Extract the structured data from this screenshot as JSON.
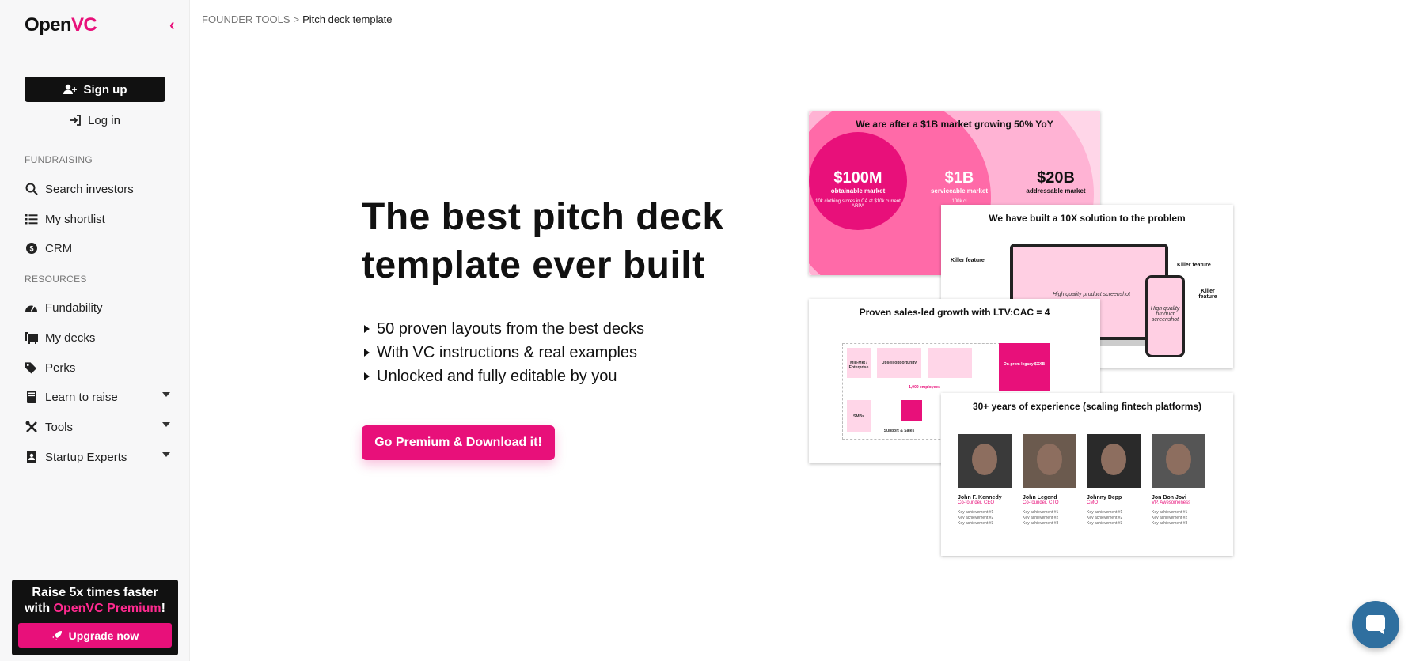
{
  "sidebar": {
    "logo": {
      "prefix": "Open",
      "accent": "VC"
    },
    "signup_label": "Sign up",
    "login_label": "Log in",
    "section_fundraising": "FUNDRAISING",
    "section_resources": "RESOURCES",
    "items": [
      {
        "label": "Search investors",
        "icon": "search-icon"
      },
      {
        "label": "My shortlist",
        "icon": "list-icon"
      },
      {
        "label": "CRM",
        "icon": "crm-icon"
      },
      {
        "label": "Fundability",
        "icon": "gauge-icon"
      },
      {
        "label": "My decks",
        "icon": "decks-icon"
      },
      {
        "label": "Perks",
        "icon": "tag-icon"
      },
      {
        "label": "Learn to raise",
        "icon": "book-icon"
      },
      {
        "label": "Tools",
        "icon": "tools-icon"
      },
      {
        "label": "Startup Experts",
        "icon": "contact-book-icon"
      }
    ],
    "promo": {
      "line1": "Raise 5x times faster",
      "line2_prefix": "with ",
      "line2_accent": "OpenVC Premium",
      "line2_suffix": "!",
      "button_label": "Upgrade now"
    }
  },
  "breadcrumb": {
    "parent": "FOUNDER TOOLS",
    "separator": ">",
    "current": "Pitch deck template"
  },
  "hero": {
    "title": "The best pitch deck template ever built",
    "bullets": [
      "50 proven layouts from the best decks",
      "With VC instructions & real examples",
      "Unlocked and fully editable by you"
    ],
    "cta_label": "Go Premium & Download it!"
  },
  "slides": {
    "market": {
      "title": "We are after a $1B market growing 50% YoY",
      "som": {
        "value": "$100M",
        "label": "obtainable market",
        "note": "10k clothing stores in CA at $10k current ARPA"
      },
      "sam": {
        "value": "$1B",
        "label": "serviceable market",
        "note": "100k cl"
      },
      "tam": {
        "value": "$20B",
        "label": "addressable market"
      }
    },
    "solution": {
      "title": "We have built a 10X solution to the problem",
      "feature_label": "Killer feature",
      "feature_label_right": "Killer feature",
      "feature_label_phone_1": "Killer",
      "feature_label_phone_2": "feature",
      "screenshot_label": "High quality product screenshot",
      "phone_label": "High quality product screenshot"
    },
    "growth": {
      "title": "Proven sales-led growth with LTV:CAC = 4",
      "segment_1": "Mid-Mkt / Enterprise",
      "segment_2": "SMBs",
      "upsell": "Upsell opportunity",
      "employees": "1,000 employees",
      "support": "Support & Sales",
      "legacy": "On-prem legacy $XXB"
    },
    "team": {
      "title": "30+ years of experience (scaling fintech platforms)",
      "members": [
        {
          "name": "John F. Kennedy",
          "role": "Co-founder, CEO",
          "a1": "Key achievement #1",
          "a2": "Key achievement #2",
          "a3": "Key achievement #3"
        },
        {
          "name": "John Legend",
          "role": "Co-founder, CTO",
          "a1": "Key achievement #1",
          "a2": "Key achievement #2",
          "a3": "Key achievement #3"
        },
        {
          "name": "Johnny Depp",
          "role": "CMO",
          "a1": "Key achievement #1",
          "a2": "Key achievement #2",
          "a3": "Key achievement #3"
        },
        {
          "name": "Jon Bon Jovi",
          "role": "VP, Awesomeness",
          "a1": "Key achievement #1",
          "a2": "Key achievement #2",
          "a3": "Key achievement #3"
        }
      ]
    }
  },
  "colors": {
    "accent": "#e8107a",
    "dark": "#111111",
    "chat": "#2f6f9f"
  }
}
